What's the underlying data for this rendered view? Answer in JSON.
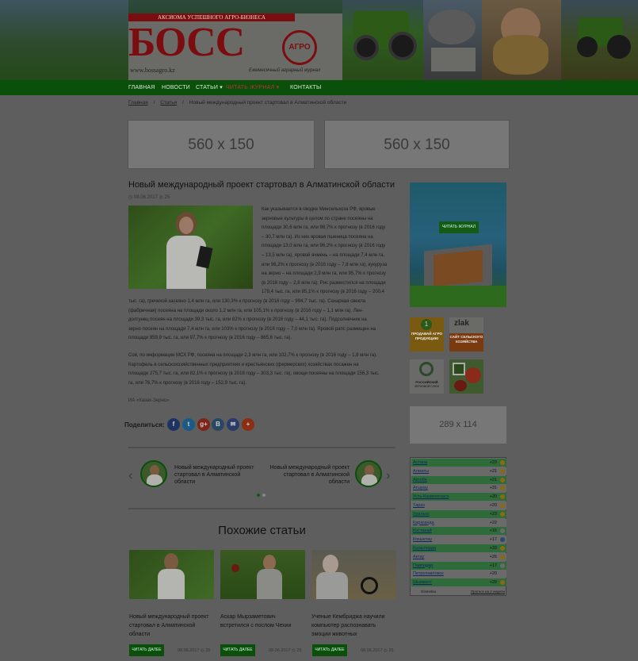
{
  "header": {
    "tagline": "АКСИОМА УСПЕШНОГО АГРО-БИЗНЕСА",
    "logo": "БОСС",
    "logo_badge": "АГРО",
    "site_url": "www.bossagro.kz",
    "journal_subtitle": "Ежемесячный аграрный журнал"
  },
  "nav": {
    "items": [
      {
        "label": "ГЛАВНАЯ"
      },
      {
        "label": "НОВОСТИ"
      },
      {
        "label": "СТАТЬИ ▾"
      },
      {
        "label": "ЧИТАТЬ ЖУРНАЛ ▾"
      },
      {
        "label": "КОНТАКТЫ"
      }
    ]
  },
  "breadcrumb": [
    "Главная",
    "/",
    "Статьи",
    "/",
    "Новый международный проект стартовал в Алматинской области"
  ],
  "banners": {
    "left": "560 x 150",
    "right": "560 x 150",
    "sidebar": "289 x 114"
  },
  "article": {
    "title": "Новый международный проект стартовал в Алматинской области",
    "date": "08.06.2017",
    "views": "25",
    "paragraph1_wrapped": [
      "Как указывается в сводке Минсельхоза РФ, яровые",
      "зерновые культуры в целом по стране посеяны на",
      "площади 30,6 млн га, или 98,7% к прогнозу (в 2016 году",
      "– 30,7 млн га). Из них яровая пшеница посеяна на",
      "площади 13,0 млн га, или 96,2% к прогнозу (в 2016 году",
      "– 13,5 млн га), яровой ячмень – на площади 7,4 млн га,",
      "или 96,2% к прогнозу (в 2016 году – 7,8 млн га), кукуруза",
      "на зерно – на площади 2,9 млн га, или 95,7% к прогнозу",
      "(в 2016 году – 2,8 млн га). Рис разместился на площади",
      "179,4 тыс. га, или 85,1% к прогнозу (в 2016 году – 200,4"
    ],
    "paragraph1_full": [
      "тыс. га), гречихой засеяно 1,4 млн га, или 130,3% к прогнозу (в 2016 году – 994,7 тыс. га). Сахарная свекла",
      "(фабричная) посеяна на площади около 1,2 млн га, или 105,1% к прогнозу (в 2016 году – 1,1 млн га). Лен-",
      "долгунец посеян на площади 39,3 тыс. га, или 82% к прогнозу (в 2016 году – 44,1 тыс. га). Подсолнечник на",
      "зерно посеян на площади 7,4 млн га, или 103% к прогнозу (в 2016 году – 7,0 млн га). Яровой рапс размещен на",
      "площади 859,9 тыс. га, или 97,7% к прогнозу (в 2016 году – 865,6 тыс. га)."
    ],
    "paragraph2": [
      "Соя, по информации МСХ РФ, посеяна на площади 2,3 млн га, или 102,7% к прогнозу (в 2016 году – 1,8 млн га).",
      "Картофель в сельскохозяйственных предприятиях и крестьянских (фермерских) хозяйствах посажен на",
      "площади 275,7 тыс. га, или 82,1% к прогнозу (в 2016 году – 303,3 тыс. га), овощи посеяны на площади 156,3 тыс.",
      "га, или 76,7% к прогнозу (в 2016 году – 152,9 тыс. га)."
    ],
    "source": "ИА «Казах-Зерно»",
    "share_label": "Поделиться:",
    "share_buttons": [
      {
        "icon": "facebook-icon",
        "glyph": "f",
        "color": "#1e3460"
      },
      {
        "icon": "twitter-icon",
        "glyph": "t",
        "color": "#1c5a86"
      },
      {
        "icon": "google-plus-icon",
        "glyph": "g+",
        "color": "#7e2418"
      },
      {
        "icon": "vk-icon",
        "glyph": "B",
        "color": "#2a4762"
      },
      {
        "icon": "mail-icon",
        "glyph": "✉",
        "color": "#2a3a6a"
      },
      {
        "icon": "more-icon",
        "glyph": "+",
        "color": "#8a2e14"
      }
    ]
  },
  "slider": {
    "items": [
      {
        "text": "Новый международный проект стартовал в Алматинской области"
      },
      {
        "text": "Новый международный проект стартовал в Алматинской области"
      }
    ]
  },
  "similar": {
    "title": "Похожие статьи",
    "items": [
      {
        "title": "Новый международный проект стартовал в Алматинской области",
        "button": "ЧИТАТЬ ДАЛЕЕ",
        "date": "08.06.2017",
        "views": "25"
      },
      {
        "title": "Аскар Мырзаметович встретился с послом Чехии",
        "button": "ЧИТАТЬ ДАЛЕЕ",
        "date": "08.06.2017",
        "views": "25"
      },
      {
        "title": "Ученые Кембриджа научили компьютер распознавать эмоции животных",
        "button": "ЧИТАТЬ ДАЛЕЕ",
        "date": "08.06.2017",
        "views": "25"
      }
    ]
  },
  "sidebar": {
    "read_journal": "ЧИТАТЬ ЖУРНАЛ",
    "logos": [
      {
        "line1": "1",
        "line2": "ПРОДАВАЙ АГРО ПРОДУКЦИЮ"
      },
      {
        "line1": "zlak",
        "line2": "САЙТ СЕЛЬСКОГО ХОЗЯЙСТВА"
      },
      {
        "line1": "РОССИЙСКИЙ",
        "line2": "ЗЕРНОВОЙ СОЮЗ"
      },
      {
        "line1": "",
        "line2": ""
      }
    ]
  },
  "weather": {
    "rows": [
      {
        "city": "Астана",
        "temp": "+23",
        "icon": "sun"
      },
      {
        "city": "Алматы",
        "temp": "+21",
        "icon": "sun"
      },
      {
        "city": "Актобе",
        "temp": "+21",
        "icon": "sun"
      },
      {
        "city": "Атырау",
        "temp": "+31",
        "icon": "sun"
      },
      {
        "city": "Усть-Каменогорск",
        "temp": "+20",
        "icon": "sun"
      },
      {
        "city": "Тараз",
        "temp": "+20",
        "icon": "sun"
      },
      {
        "city": "Уральск",
        "temp": "+23",
        "icon": "sun"
      },
      {
        "city": "Караганда",
        "temp": "+22",
        "icon": "cloud"
      },
      {
        "city": "Костанай",
        "temp": "+16",
        "icon": "cloud"
      },
      {
        "city": "Кокшетау",
        "temp": "+17",
        "icon": "rain"
      },
      {
        "city": "Кызылорда",
        "temp": "+33",
        "icon": "sun"
      },
      {
        "city": "Актау",
        "temp": "+26",
        "icon": "sun"
      },
      {
        "city": "Павлодар",
        "temp": "+17",
        "icon": "cloud"
      },
      {
        "city": "Петропавловск",
        "temp": "+20",
        "icon": "cloud"
      },
      {
        "city": "Шымкент",
        "temp": "+29",
        "icon": "sun"
      }
    ],
    "provider": "Gismeteo",
    "forecast_link": "Прогноз на 2 недели"
  }
}
